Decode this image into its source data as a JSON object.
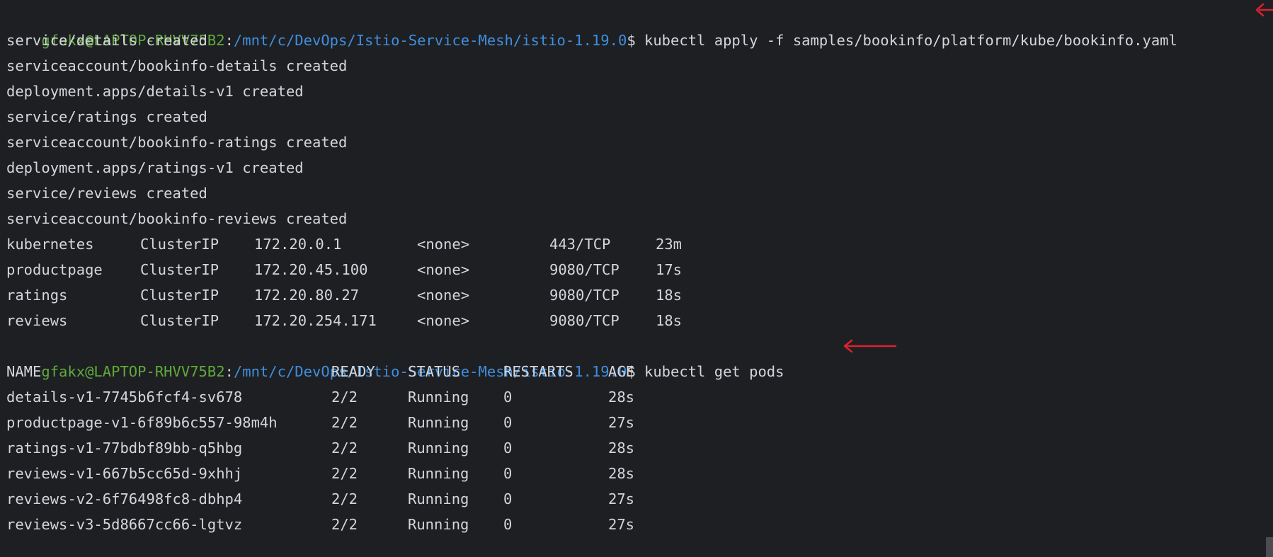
{
  "prompt": {
    "user_host": "gfakx@LAPTOP-RHVV75B2",
    "path": "/mnt/c/DevOps/Istio-Service-Mesh/istio-1.19.0",
    "colon": ":",
    "dollar": "$"
  },
  "commands": {
    "apply": " kubectl apply -f samples/bookinfo/platform/kube/bookinfo.yaml",
    "get_pods": " kubectl get pods"
  },
  "apply_output": [
    "service/details created",
    "serviceaccount/bookinfo-details created",
    "deployment.apps/details-v1 created",
    "service/ratings created",
    "serviceaccount/bookinfo-ratings created",
    "deployment.apps/ratings-v1 created",
    "service/reviews created",
    "serviceaccount/bookinfo-reviews created"
  ],
  "services": [
    {
      "name": "kubernetes",
      "type": "ClusterIP",
      "cluster_ip": "172.20.0.1",
      "external_ip": "<none>",
      "ports": "443/TCP",
      "age": "23m"
    },
    {
      "name": "productpage",
      "type": "ClusterIP",
      "cluster_ip": "172.20.45.100",
      "external_ip": "<none>",
      "ports": "9080/TCP",
      "age": "17s"
    },
    {
      "name": "ratings",
      "type": "ClusterIP",
      "cluster_ip": "172.20.80.27",
      "external_ip": "<none>",
      "ports": "9080/TCP",
      "age": "18s"
    },
    {
      "name": "reviews",
      "type": "ClusterIP",
      "cluster_ip": "172.20.254.171",
      "external_ip": "<none>",
      "ports": "9080/TCP",
      "age": "18s"
    }
  ],
  "pods": {
    "headers": [
      "NAME",
      "READY",
      "STATUS",
      "RESTARTS",
      "AGE"
    ],
    "rows": [
      [
        "details-v1-7745b6fcf4-sv678",
        "2/2",
        "Running",
        "0",
        "28s"
      ],
      [
        "productpage-v1-6f89b6c557-98m4h",
        "2/2",
        "Running",
        "0",
        "27s"
      ],
      [
        "ratings-v1-77bdbf89bb-q5hbg",
        "2/2",
        "Running",
        "0",
        "28s"
      ],
      [
        "reviews-v1-667b5cc65d-9xhhj",
        "2/2",
        "Running",
        "0",
        "28s"
      ],
      [
        "reviews-v2-6f76498fc8-dbhp4",
        "2/2",
        "Running",
        "0",
        "27s"
      ],
      [
        "reviews-v3-5d8667cc66-lgtvz",
        "2/2",
        "Running",
        "0",
        "27s"
      ]
    ]
  },
  "colors": {
    "background": "#1e1f22",
    "text": "#d4d6dc",
    "prompt_user": "#5faa3c",
    "prompt_path": "#3e8fe0",
    "annotation_arrow": "#d9232e"
  },
  "icons": {
    "annotation": "left-arrow-icon"
  }
}
